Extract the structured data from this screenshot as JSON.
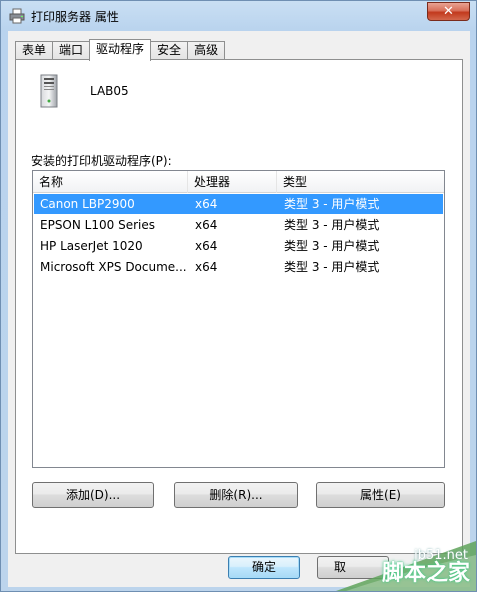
{
  "window": {
    "title": "打印服务器 属性",
    "close_glyph": "✕"
  },
  "tabs": [
    {
      "label": "表单",
      "active": false
    },
    {
      "label": "端口",
      "active": false
    },
    {
      "label": "驱动程序",
      "active": true
    },
    {
      "label": "安全",
      "active": false
    },
    {
      "label": "高级",
      "active": false
    }
  ],
  "server": {
    "name": "LAB05",
    "icon": "server-tower-icon"
  },
  "drivers": {
    "label": "安装的打印机驱动程序(P):",
    "columns": [
      "名称",
      "处理器",
      "类型"
    ],
    "rows": [
      {
        "name": "Canon LBP2900",
        "processor": "x64",
        "type": "类型 3 - 用户模式",
        "selected": true
      },
      {
        "name": "EPSON L100 Series",
        "processor": "x64",
        "type": "类型 3 - 用户模式",
        "selected": false
      },
      {
        "name": "HP LaserJet 1020",
        "processor": "x64",
        "type": "类型 3 - 用户模式",
        "selected": false
      },
      {
        "name": "Microsoft XPS Docume...",
        "processor": "x64",
        "type": "类型 3 - 用户模式",
        "selected": false
      }
    ]
  },
  "buttons": {
    "add": "添加(D)...",
    "remove": "删除(R)...",
    "properties": "属性(E)",
    "ok": "确定",
    "cancel": "取"
  },
  "watermark": {
    "site": "jb51.net",
    "brand": "脚本之家"
  },
  "colors": {
    "selection": "#3399ff",
    "title_gradient": "#b9d3ee",
    "close": "#c2391d"
  }
}
